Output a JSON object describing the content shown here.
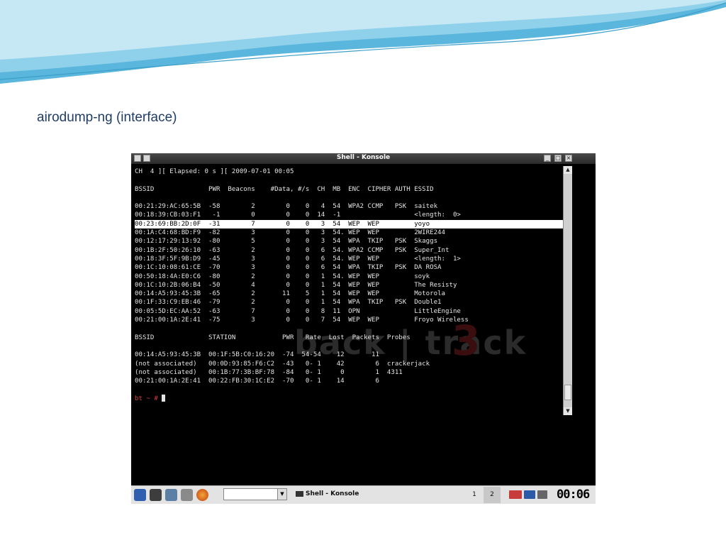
{
  "slide": {
    "title": "airodump-ng (interface)"
  },
  "window": {
    "title": "Shell - Konsole"
  },
  "terminal": {
    "status_line": "CH  4 ][ Elapsed: 0 s ][ 2009-07-01 00:05",
    "ap_header": "BSSID              PWR  Beacons    #Data, #/s  CH  MB  ENC  CIPHER AUTH ESSID",
    "ap_rows": [
      "00:21:29:AC:65:5B  -58        2        0    0   4  54  WPA2 CCMP   PSK  saitek",
      "00:18:39:CB:03:F1   -1        0        0    0  14  -1                   <length:  0>",
      "00:23:69:BB:2D:0F  -31        7        0    0   3  54  WEP  WEP         yoyo",
      "00:1A:C4:68:BD:F9  -82        3        0    0   3  54. WEP  WEP         2WIRE244",
      "00:12:17:29:13:92  -80        5        0    0   3  54  WPA  TKIP   PSK  Skaggs",
      "00:1B:2F:50:26:10  -63        2        0    0   6  54. WPA2 CCMP   PSK  Super_Int",
      "00:18:3F:5F:9B:D9  -45        3        0    0   6  54. WEP  WEP         <length:  1>",
      "00:1C:10:08:61:CE  -70        3        0    0   6  54  WPA  TKIP   PSK  DA ROSA",
      "00:50:18:4A:E0:C6  -80        2        0    0   1  54. WEP  WEP         soyk",
      "00:1C:10:2B:06:B4  -50        4        0    0   1  54  WEP  WEP         The Resisty",
      "00:14:A5:93:45:3B  -65        2       11    5   1  54  WEP  WEP         Motorola",
      "00:1F:33:C9:EB:46  -79        2        0    0   1  54  WPA  TKIP   PSK  Double1",
      "00:05:5D:EC:AA:52  -63        7        0    0   8  11  OPN              LittleEngine",
      "00:21:00:1A:2E:41  -75        3        0    0   7  54  WEP  WEP         Froyo Wireless"
    ],
    "highlighted_row": 2,
    "station_header": "BSSID              STATION            PWR   Rate  Lost  Packets  Probes",
    "station_rows": [
      "00:14:A5:93:45:3B  00:1F:5B:C0:16:20  -74  54-54    12       11",
      "(not associated)   00:0D:93:85:F6:C2  -43   0- 1    42        6  crackerjack",
      "(not associated)   00:1B:77:3B:BF:78  -84   0- 1     0        1  4311",
      "00:21:00:1A:2E:41  00:22:FB:30:1C:E2  -70   0- 1    14        6"
    ],
    "prompt": "bt ~ # ",
    "background_logo": "back | track",
    "background_number": "3"
  },
  "taskbar": {
    "task_label": "Shell - Konsole",
    "pager": [
      "1",
      "2"
    ],
    "clock": "00:06",
    "icons": [
      "kde-menu-icon",
      "desktop-icon",
      "network-icon",
      "settings-icon",
      "firefox-icon",
      "keyboard-layout-icon",
      "us-flag-icon",
      "mail-icon",
      "volume-icon"
    ]
  }
}
